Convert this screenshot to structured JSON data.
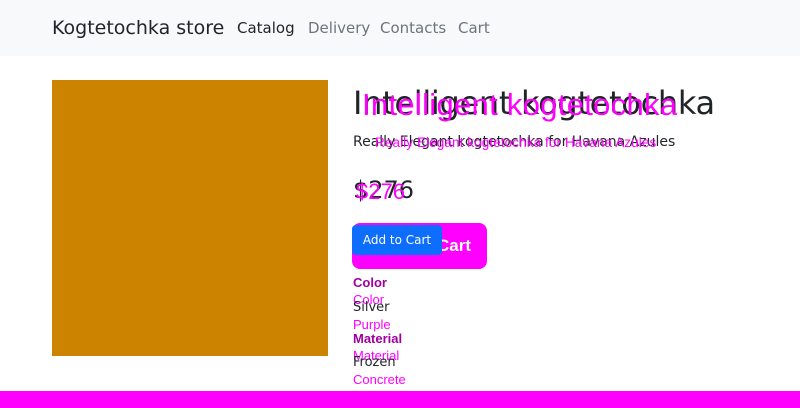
{
  "nav": {
    "brand": "Kogtetochka store",
    "links": [
      "Catalog",
      "Delivery",
      "Contacts",
      "Cart"
    ]
  },
  "product": {
    "image_color": "#cc8400",
    "title": "Intelligent kogtetochka",
    "description": "Really Elegant kogtetochka for Havana Azules",
    "price": "$276",
    "add_to_cart": "Add to Cart"
  },
  "properties": {
    "color_label": "Color",
    "color_values": [
      "Silver",
      "Purple"
    ],
    "material_label": "Material",
    "material_values": [
      "Frozen",
      "Concrete"
    ]
  },
  "colors": {
    "accent": "#ff00ff",
    "button": "#0d6efd",
    "navbar_bg": "#f8f9fa"
  }
}
